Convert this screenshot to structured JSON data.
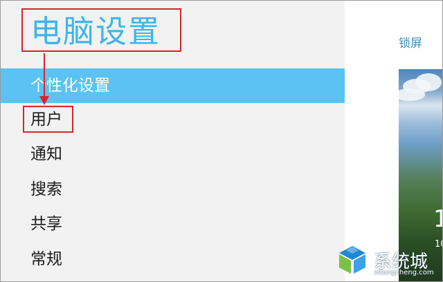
{
  "app_title": "电脑设置",
  "nav": {
    "items": [
      {
        "label": "个性化设置",
        "selected": true
      },
      {
        "label": "用户",
        "selected": false
      },
      {
        "label": "通知",
        "selected": false
      },
      {
        "label": "搜索",
        "selected": false
      },
      {
        "label": "共享",
        "selected": false
      },
      {
        "label": "常规",
        "selected": false
      }
    ]
  },
  "right": {
    "heading": "锁屏",
    "clock_partial": "1",
    "date_partial": "10"
  },
  "watermark": {
    "name": "系统城",
    "url": "xitongcheng.com"
  },
  "colors": {
    "accent": "#5bc3f4",
    "title": "#3fb4e8",
    "annotation": "#d9232a",
    "pane_background": "#f2f2f2"
  },
  "icons": {
    "watermark_logo": "windows-logo-icon"
  }
}
